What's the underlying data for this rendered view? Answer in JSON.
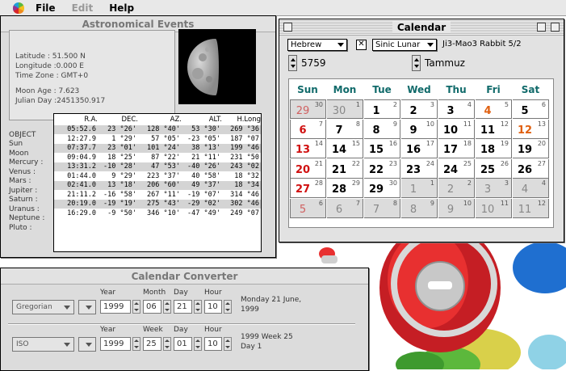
{
  "menubar": {
    "items": [
      {
        "label": "File",
        "enabled": true
      },
      {
        "label": "Edit",
        "enabled": false
      },
      {
        "label": "Help",
        "enabled": true
      }
    ]
  },
  "astro": {
    "title": "Astronomical Events",
    "info": [
      "Latitude : 51.500 N",
      "Longitude :0.000 E",
      "Time Zone : GMT+0",
      "Moon Age : 7.623",
      "Julian Day :2451350.917"
    ],
    "object_header": "OBJECT",
    "headers": [
      "R.A.",
      "DEC.",
      "AZ.",
      "ALT.",
      "H.Long"
    ],
    "objects": [
      "Sun",
      "Moon",
      "Mercury :",
      "Venus :",
      "Mars :",
      "Jupiter :",
      "Saturn :",
      "Uranus :",
      "Neptune :",
      "Pluto :"
    ],
    "rows": [
      [
        "05:52.6",
        "23 °26'",
        "128 °40'",
        "53 °30'",
        "269 °36"
      ],
      [
        "12:27.9",
        "1 °29'",
        "57 °05'",
        "-23 °05'",
        "187 °07"
      ],
      [
        "07:37.7",
        "23 °01'",
        "101 °24'",
        "38 °13'",
        "199 °46"
      ],
      [
        "09:04.9",
        "18 °25'",
        "87 °22'",
        "21 °11'",
        "231 °50"
      ],
      [
        "13:31.2",
        "-10 °28'",
        "47 °53'",
        "-40 °26'",
        "243 °02"
      ],
      [
        "01:44.0",
        "9 °29'",
        "223 °37'",
        "40 °58'",
        "18 °32"
      ],
      [
        "02:41.0",
        "13 °18'",
        "206 °60'",
        "49 °37'",
        "18 °34"
      ],
      [
        "21:11.2",
        "-16 °58'",
        "267 °11'",
        "-19 °07'",
        "314 °46"
      ],
      [
        "20:19.0",
        "-19 °19'",
        "275 °43'",
        "-29 °02'",
        "302 °46"
      ],
      [
        "16:29.0",
        "-9 °50'",
        "346 °10'",
        "-47 °49'",
        "249 °07"
      ]
    ]
  },
  "calendar": {
    "title": "Calendar",
    "system": "Hebrew",
    "alt_system": "Sinic Lunar",
    "alt_info": "Ji3-Mao3 Rabbit 5/2",
    "year": "5759",
    "month": "Tammuz",
    "weekdays": [
      "Sun",
      "Mon",
      "Tue",
      "Wed",
      "Thu",
      "Fri",
      "Sat"
    ],
    "weeks": [
      [
        {
          "d": "29",
          "s": "30",
          "t": "p"
        },
        {
          "d": "30",
          "s": "1",
          "t": "p"
        },
        {
          "d": "1",
          "s": "2",
          "t": "c"
        },
        {
          "d": "2",
          "s": "3",
          "t": "c"
        },
        {
          "d": "3",
          "s": "4",
          "t": "c"
        },
        {
          "d": "4",
          "s": "5",
          "t": "f"
        },
        {
          "d": "5",
          "s": "6",
          "t": "c"
        }
      ],
      [
        {
          "d": "6",
          "s": "7",
          "t": "s"
        },
        {
          "d": "7",
          "s": "8",
          "t": "c"
        },
        {
          "d": "8",
          "s": "9",
          "t": "c"
        },
        {
          "d": "9",
          "s": "10",
          "t": "c"
        },
        {
          "d": "10",
          "s": "11",
          "t": "c"
        },
        {
          "d": "11",
          "s": "12",
          "t": "c"
        },
        {
          "d": "12",
          "s": "13",
          "t": "f"
        }
      ],
      [
        {
          "d": "13",
          "s": "14",
          "t": "s"
        },
        {
          "d": "14",
          "s": "15",
          "t": "c"
        },
        {
          "d": "15",
          "s": "16",
          "t": "c"
        },
        {
          "d": "16",
          "s": "17",
          "t": "c"
        },
        {
          "d": "17",
          "s": "18",
          "t": "c"
        },
        {
          "d": "18",
          "s": "19",
          "t": "c"
        },
        {
          "d": "19",
          "s": "20",
          "t": "c"
        }
      ],
      [
        {
          "d": "20",
          "s": "21",
          "t": "s"
        },
        {
          "d": "21",
          "s": "22",
          "t": "c"
        },
        {
          "d": "22",
          "s": "23",
          "t": "c"
        },
        {
          "d": "23",
          "s": "24",
          "t": "c"
        },
        {
          "d": "24",
          "s": "25",
          "t": "c"
        },
        {
          "d": "25",
          "s": "26",
          "t": "c"
        },
        {
          "d": "26",
          "s": "27",
          "t": "c"
        }
      ],
      [
        {
          "d": "27",
          "s": "28",
          "t": "s"
        },
        {
          "d": "28",
          "s": "29",
          "t": "c"
        },
        {
          "d": "29",
          "s": "30",
          "t": "c"
        },
        {
          "d": "1",
          "s": "1",
          "t": "n"
        },
        {
          "d": "2",
          "s": "2",
          "t": "n"
        },
        {
          "d": "3",
          "s": "3",
          "t": "n"
        },
        {
          "d": "4",
          "s": "4",
          "t": "n"
        }
      ],
      [
        {
          "d": "5",
          "s": "6",
          "t": "ns"
        },
        {
          "d": "6",
          "s": "7",
          "t": "n"
        },
        {
          "d": "7",
          "s": "8",
          "t": "n"
        },
        {
          "d": "8",
          "s": "9",
          "t": "n"
        },
        {
          "d": "9",
          "s": "10",
          "t": "n"
        },
        {
          "d": "10",
          "s": "11",
          "t": "n"
        },
        {
          "d": "11",
          "s": "12",
          "t": "n"
        }
      ]
    ],
    "colors": {
      "sunday": "#d01010",
      "friday": "#e06010",
      "current": "#000000",
      "other": "#888888",
      "other_sunday": "#d06060",
      "header": "#106a6a"
    }
  },
  "converter": {
    "title": "Calendar Converter",
    "labels": {
      "year": "Year",
      "month": "Month",
      "day": "Day",
      "hour": "Hour",
      "week": "Week"
    },
    "row1": {
      "system": "Gregorian",
      "year": "1999",
      "month": "06",
      "day": "21",
      "hour": "10",
      "result1": "Monday 21 June,",
      "result2": "1999"
    },
    "row2": {
      "system": "ISO",
      "year": "1999",
      "week": "25",
      "day": "01",
      "hour": "10",
      "result1": "1999 Week 25",
      "result2": "Day 1"
    }
  }
}
